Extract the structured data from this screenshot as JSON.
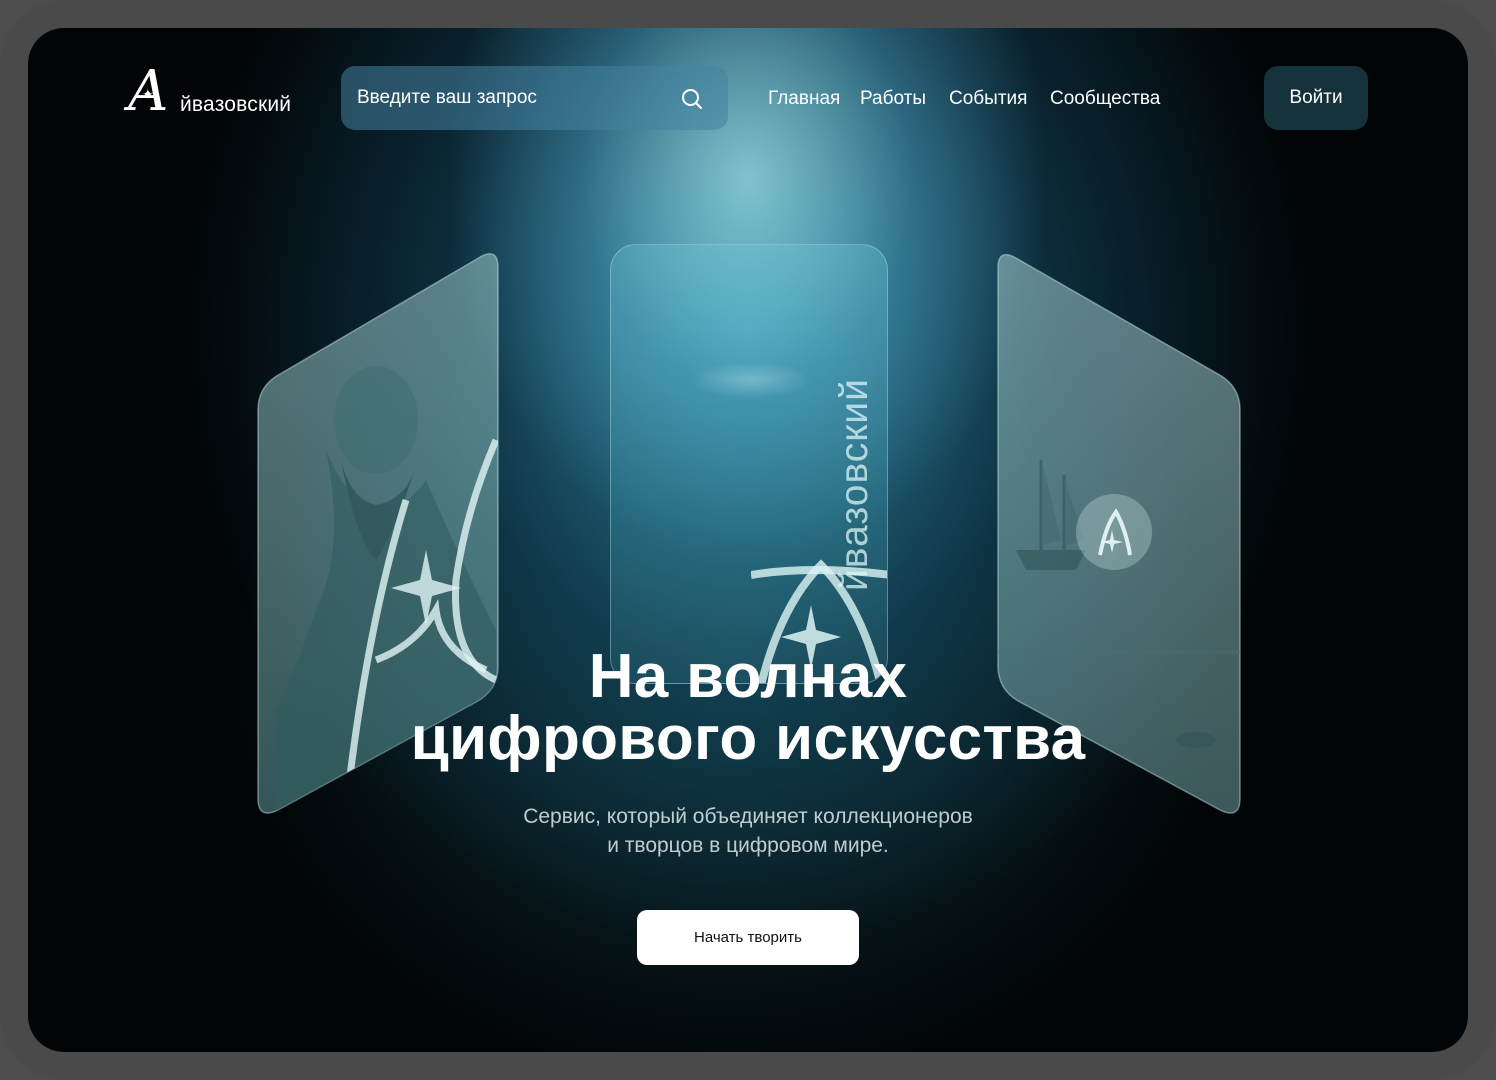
{
  "brand": {
    "letter": "A",
    "name": "йвазовский"
  },
  "search": {
    "placeholder": "Введите ваш запрос",
    "icon": "search-icon"
  },
  "nav": {
    "items": [
      {
        "label": "Главная"
      },
      {
        "label": "Работы"
      },
      {
        "label": "События"
      },
      {
        "label": "Сообщества"
      }
    ]
  },
  "header": {
    "login_label": "Войти"
  },
  "cards": {
    "center_text": "йвазовский"
  },
  "hero": {
    "title_line1": "На волнах",
    "title_line2": "цифрового искусства",
    "subtitle_line1": "Сервис, который объединяет коллекционеров",
    "subtitle_line2": "и творцов в цифровом мире.",
    "cta_label": "Начать творить"
  },
  "colors": {
    "background": "#020507",
    "glow": "#7fd0e0",
    "cta_bg": "#ffffff",
    "cta_text": "#111111"
  }
}
